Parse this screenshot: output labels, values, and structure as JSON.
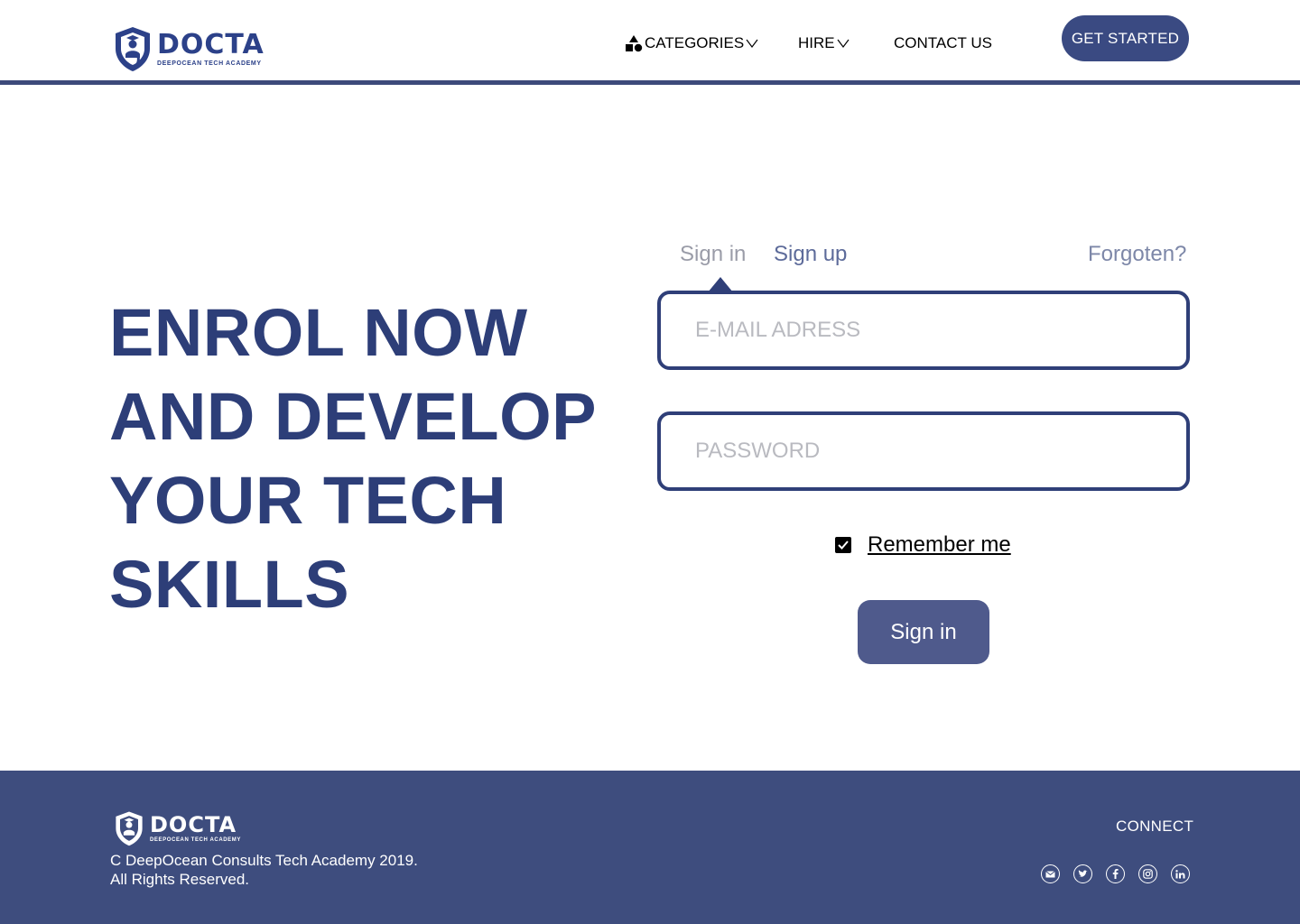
{
  "header": {
    "logo_word": "DOCTA",
    "logo_sub": "DEEPOCEAN TECH ACADEMY",
    "nav": {
      "categories": "CATEGORIES",
      "hire": "HIRE",
      "contact": "CONTACT US"
    },
    "cta": "GET STARTED"
  },
  "hero": {
    "line1": "ENROL NOW",
    "line2": "AND DEVELOP",
    "line3": "YOUR TECH",
    "line4": "SKILLS"
  },
  "form": {
    "tab_signin": "Sign in",
    "tab_signup": "Sign up",
    "forgot": "Forgoten?",
    "email_placeholder": "E-MAIL ADRESS",
    "password_placeholder": "PASSWORD",
    "remember": "Remember me",
    "remember_checked": true,
    "submit": "Sign in"
  },
  "footer": {
    "logo_word": "DOCTA",
    "logo_sub": "DEEPOCEAN TECH ACADEMY",
    "copyright_line1": "C DeepOcean Consults Tech Academy 2019.",
    "copyright_line2": "All Rights Reserved.",
    "connect": "CONNECT",
    "socials": [
      "email-icon",
      "twitter-icon",
      "facebook-icon",
      "instagram-icon",
      "linkedin-icon"
    ]
  },
  "colors": {
    "brand": "#2d3e78",
    "footer_bg": "#3e4d7e",
    "button": "#3a4a82",
    "muted_tab": "#9a9ca8"
  }
}
